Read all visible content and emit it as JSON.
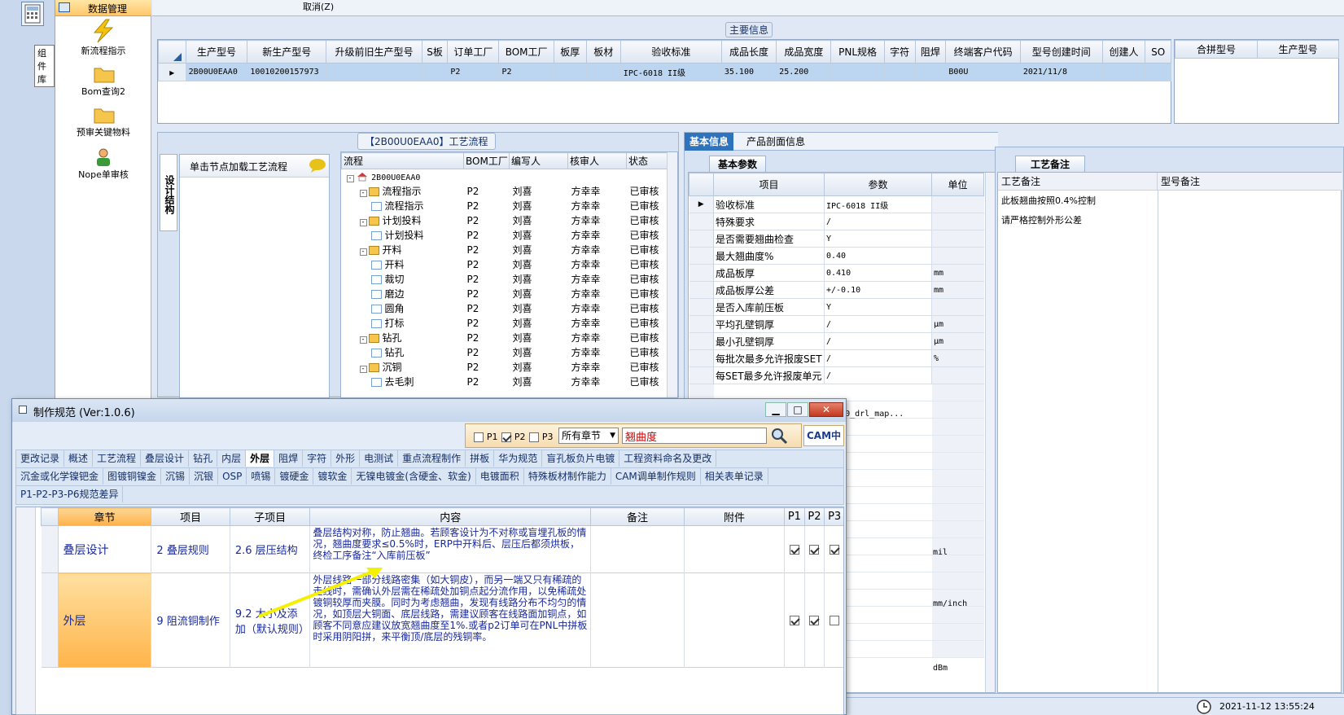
{
  "colors": {
    "accent": "#2f73bd",
    "selected_row": "#bcd5f0",
    "highlight_row": "#ffc15a",
    "header_bg": "#dde6f2"
  },
  "toolbar": {
    "component_lib": "组件库",
    "data_mgmt": "数据管理",
    "top_cancel": "取消(Z)"
  },
  "nav": {
    "items": [
      {
        "label": "新流程指示",
        "icon": "lightning-icon"
      },
      {
        "label": "Bom查询2",
        "icon": "folder-icon"
      },
      {
        "label": "预审关键物料",
        "icon": "folder-icon"
      },
      {
        "label": "Nope单审核",
        "icon": "person-icon"
      }
    ]
  },
  "main_info": {
    "title": "主要信息",
    "columns": [
      "生产型号",
      "新生产型号",
      "升级前旧生产型号",
      "S板",
      "订单工厂",
      "BOM工厂",
      "板厚",
      "板材",
      "验收标准",
      "成品长度",
      "成品宽度",
      "PNL规格",
      "字符",
      "阻焊",
      "终端客户代码",
      "型号创建时间",
      "创建人",
      "SO"
    ],
    "row": [
      "2B00U0EAA0",
      "10010200157973",
      "",
      "",
      "P2",
      "P2",
      "",
      "",
      "IPC-6018 II级",
      "35.100",
      "25.200",
      "",
      "",
      "",
      "B00U",
      "2021/11/8",
      "",
      ""
    ],
    "side_columns": [
      "合拼型号",
      "生产型号"
    ]
  },
  "process": {
    "title": "【2B00U0EAA0】工艺流程",
    "side_tab": "设计结构",
    "load_hint": "单击节点加载工艺流程",
    "columns": [
      "流程",
      "BOM工厂",
      "编写人",
      "核审人",
      "状态"
    ],
    "root": "2B00U0EAA0",
    "rows": [
      {
        "name": "流程指示",
        "level": 1,
        "folder": true,
        "bom": "P2",
        "writer": "刘喜",
        "reviewer": "方幸幸",
        "status": "已审核"
      },
      {
        "name": "流程指示",
        "level": 2,
        "folder": false,
        "bom": "P2",
        "writer": "刘喜",
        "reviewer": "方幸幸",
        "status": "已审核"
      },
      {
        "name": "计划投料",
        "level": 1,
        "folder": true,
        "bom": "P2",
        "writer": "刘喜",
        "reviewer": "方幸幸",
        "status": "已审核"
      },
      {
        "name": "计划投料",
        "level": 2,
        "folder": false,
        "bom": "P2",
        "writer": "刘喜",
        "reviewer": "方幸幸",
        "status": "已审核"
      },
      {
        "name": "开料",
        "level": 1,
        "folder": true,
        "bom": "P2",
        "writer": "刘喜",
        "reviewer": "方幸幸",
        "status": "已审核"
      },
      {
        "name": "开料",
        "level": 2,
        "folder": false,
        "bom": "P2",
        "writer": "刘喜",
        "reviewer": "方幸幸",
        "status": "已审核"
      },
      {
        "name": "裁切",
        "level": 2,
        "folder": false,
        "bom": "P2",
        "writer": "刘喜",
        "reviewer": "方幸幸",
        "status": "已审核"
      },
      {
        "name": "磨边",
        "level": 2,
        "folder": false,
        "bom": "P2",
        "writer": "刘喜",
        "reviewer": "方幸幸",
        "status": "已审核"
      },
      {
        "name": "圆角",
        "level": 2,
        "folder": false,
        "bom": "P2",
        "writer": "刘喜",
        "reviewer": "方幸幸",
        "status": "已审核"
      },
      {
        "name": "打标",
        "level": 2,
        "folder": false,
        "bom": "P2",
        "writer": "刘喜",
        "reviewer": "方幸幸",
        "status": "已审核"
      },
      {
        "name": "钻孔",
        "level": 1,
        "folder": true,
        "bom": "P2",
        "writer": "刘喜",
        "reviewer": "方幸幸",
        "status": "已审核"
      },
      {
        "name": "钻孔",
        "level": 2,
        "folder": false,
        "bom": "P2",
        "writer": "刘喜",
        "reviewer": "方幸幸",
        "status": "已审核"
      },
      {
        "name": "沉铜",
        "level": 1,
        "folder": true,
        "bom": "P2",
        "writer": "刘喜",
        "reviewer": "方幸幸",
        "status": "已审核"
      },
      {
        "name": "去毛刺",
        "level": 2,
        "folder": false,
        "bom": "P2",
        "writer": "刘喜",
        "reviewer": "方幸幸",
        "status": "已审核"
      }
    ]
  },
  "basic": {
    "tabs": [
      "基本信息",
      "产品剖面信息"
    ],
    "subtab": "基本参数",
    "columns": [
      "项目",
      "参数",
      "单位"
    ],
    "rows": [
      {
        "item": "验收标准",
        "param": "IPC-6018 II级",
        "unit": ""
      },
      {
        "item": "特殊要求",
        "param": "/",
        "unit": ""
      },
      {
        "item": "是否需要翘曲检查",
        "param": "Y",
        "unit": ""
      },
      {
        "item": "最大翘曲度%",
        "param": "0.40",
        "unit": ""
      },
      {
        "item": "成品板厚",
        "param": "0.410",
        "unit": "mm"
      },
      {
        "item": "成品板厚公差",
        "param": "+/-0.10",
        "unit": "mm"
      },
      {
        "item": "是否入库前压板",
        "param": "Y",
        "unit": ""
      },
      {
        "item": "平均孔壁铜厚",
        "param": "/",
        "unit": "μm"
      },
      {
        "item": "最小孔壁铜厚",
        "param": "/",
        "unit": "μm"
      },
      {
        "item": "每批次最多允许报废SET",
        "param": "/",
        "unit": "%"
      },
      {
        "item": "每SET最多允许报废单元",
        "param": "/",
        "unit": ""
      }
    ],
    "extra": {
      "drl_map": "0eaa0_drl_map...",
      "unit_mil": "mil",
      "unit_mminch": "mm/inch",
      "unit_dbm": "dBm"
    }
  },
  "remarks": {
    "tab": "工艺备注",
    "col1": "工艺备注",
    "col2": "型号备注",
    "lines": [
      "此板翘曲按照0.4%控制",
      "请严格控制外形公差"
    ]
  },
  "status": {
    "datetime": "2021-11-12 13:55:24"
  },
  "dialog": {
    "title": "制作规范 (Ver:1.0.6)",
    "filters": [
      {
        "label": "P1",
        "checked": false
      },
      {
        "label": "P2",
        "checked": true
      },
      {
        "label": "P3",
        "checked": false
      }
    ],
    "chapter_select": "所有章节",
    "search_value": "翘曲度",
    "logo": "CAM中心",
    "tabs_row1": [
      "更改记录",
      "概述",
      "工艺流程",
      "叠层设计",
      "钻孔",
      "内层",
      "外层",
      "阻焊",
      "字符",
      "外形",
      "电测试",
      "重点流程制作",
      "拼板",
      "华为规范",
      "盲孔板负片电镀",
      "工程资料命名及更改"
    ],
    "tabs_row2": [
      "沉金或化学镍钯金",
      "图镀铜镍金",
      "沉锡",
      "沉银",
      "OSP",
      "喷锡",
      "镀硬金",
      "镀软金",
      "无镍电镀金(含硬金、软金)",
      "电镀面积",
      "特殊板材制作能力",
      "CAM调单制作规则",
      "相关表单记录"
    ],
    "tabs_row3": [
      "P1-P2-P3-P6规范差异"
    ],
    "active_tab": "外层",
    "columns": [
      "章节",
      "项目",
      "子项目",
      "内容",
      "备注",
      "附件",
      "P1",
      "P2",
      "P3"
    ],
    "rows": [
      {
        "chapter": "叠层设计",
        "item": "2 叠层规则",
        "sub": "2.6 层压结构",
        "content": "叠层结构对称，防止翘曲。若顾客设计为不对称或盲埋孔板的情况，翘曲度要求≤0.5%时，ERP中开料后、层压后都须烘板，终检工序备注“入库前压板”",
        "note": "",
        "attach": "",
        "p1": true,
        "p2": true,
        "p3": true
      },
      {
        "chapter": "外层",
        "item": "9 阻流铜制作",
        "sub": "9.2 大小及添加（默认规则）",
        "content": "外层线路一部分线路密集（如大铜皮），而另一端又只有稀疏的走线时，需确认外层需在稀疏处加铜点起分流作用，以免稀疏处镀铜较厚而夹膜。同时为考虑翘曲，发现有线路分布不均匀的情况，如顶层大铜面、底层线路，需建议顾客在线路面加铜点，如顾客不同意应建议放宽翘曲度至1%.或者p2订单可在PNL中拼板时采用阴阳拼，来平衡顶/底层的残铜率。",
        "note": "",
        "attach": "",
        "p1": true,
        "p2": true,
        "p3": false
      }
    ]
  }
}
